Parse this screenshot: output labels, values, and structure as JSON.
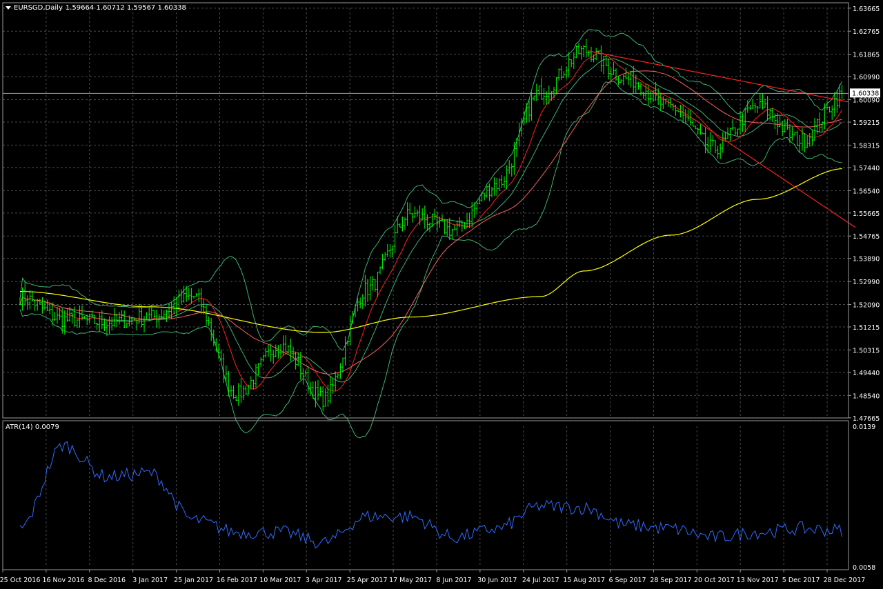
{
  "window": {
    "symbol_label": "EURSGD,Daily",
    "ohlc": "1.59664 1.60712 1.59567 1.60338"
  },
  "indicator": {
    "label": "ATR(14) 0.0079"
  },
  "colors": {
    "background": "#000000",
    "grid": "#4a4a4a",
    "candle": "#00ff00",
    "bollinger": "#3cb371",
    "ma_fast": "#ff2020",
    "ma_mid": "#ff6060",
    "ma_slow": "#ffff00",
    "trendline": "#ff2020",
    "atr": "#2e6cff",
    "price_line": "#a0a0a0",
    "text": "#ffffff"
  },
  "chart_data": [
    {
      "type": "candlestick",
      "symbol": "EURSGD",
      "timeframe": "Daily",
      "ylim": [
        1.4766,
        1.6366
      ],
      "price_ticks": [
        "1.63665",
        "1.62765",
        "1.61865",
        "1.60990",
        "1.60090",
        "1.59215",
        "1.58315",
        "1.57440",
        "1.56540",
        "1.55665",
        "1.54765",
        "1.53890",
        "1.52990",
        "1.52090",
        "1.51215",
        "1.50315",
        "1.49440",
        "1.48540",
        "1.47665"
      ],
      "current_price": "1.60338",
      "date_labels": [
        "25 Oct 2016",
        "16 Nov 2016",
        "8 Dec 2016",
        "3 Jan 2017",
        "25 Jan 2017",
        "16 Feb 2017",
        "10 Mar 2017",
        "3 Apr 2017",
        "25 Apr 2017",
        "17 May 2017",
        "8 Jun 2017",
        "30 Jun 2017",
        "24 Jul 2017",
        "15 Aug 2017",
        "6 Sep 2017",
        "28 Sep 2017",
        "20 Oct 2017",
        "13 Nov 2017",
        "5 Dec 2017",
        "28 Dec 2017"
      ],
      "approx_close": [
        [
          "25 Oct 2016",
          1.524
        ],
        [
          "16 Nov 2016",
          1.515
        ],
        [
          "8 Dec 2016",
          1.514
        ],
        [
          "3 Jan 2017",
          1.516
        ],
        [
          "25 Jan 2017",
          1.524
        ],
        [
          "16 Feb 2017",
          1.486
        ],
        [
          "10 Mar 2017",
          1.505
        ],
        [
          "3 Apr 2017",
          1.484
        ],
        [
          "25 Apr 2017",
          1.527
        ],
        [
          "17 May 2017",
          1.556
        ],
        [
          "8 Jun 2017",
          1.55
        ],
        [
          "30 Jun 2017",
          1.568
        ],
        [
          "24 Jul 2017",
          1.604
        ],
        [
          "15 Aug 2017",
          1.62
        ],
        [
          "6 Sep 2017",
          1.609
        ],
        [
          "28 Sep 2017",
          1.598
        ],
        [
          "20 Oct 2017",
          1.582
        ],
        [
          "13 Nov 2017",
          1.598
        ],
        [
          "5 Dec 2017",
          1.585
        ],
        [
          "28 Dec 2017",
          1.603
        ]
      ],
      "moving_average_slow_approx": [
        [
          "25 Oct 2016",
          1.526
        ],
        [
          "3 Jan 2017",
          1.52
        ],
        [
          "3 Apr 2017",
          1.51
        ],
        [
          "17 May 2017",
          1.516
        ],
        [
          "24 Jul 2017",
          1.524
        ],
        [
          "15 Aug 2017",
          1.534
        ],
        [
          "28 Sep 2017",
          1.548
        ],
        [
          "13 Nov 2017",
          1.562
        ],
        [
          "28 Dec 2017",
          1.574
        ]
      ]
    },
    {
      "type": "line",
      "name": "ATR(14)",
      "ylim": [
        0.0058,
        0.0139
      ],
      "value_ticks": [
        "0.0139",
        "0.0058"
      ],
      "last_value": "0.0079"
    }
  ]
}
